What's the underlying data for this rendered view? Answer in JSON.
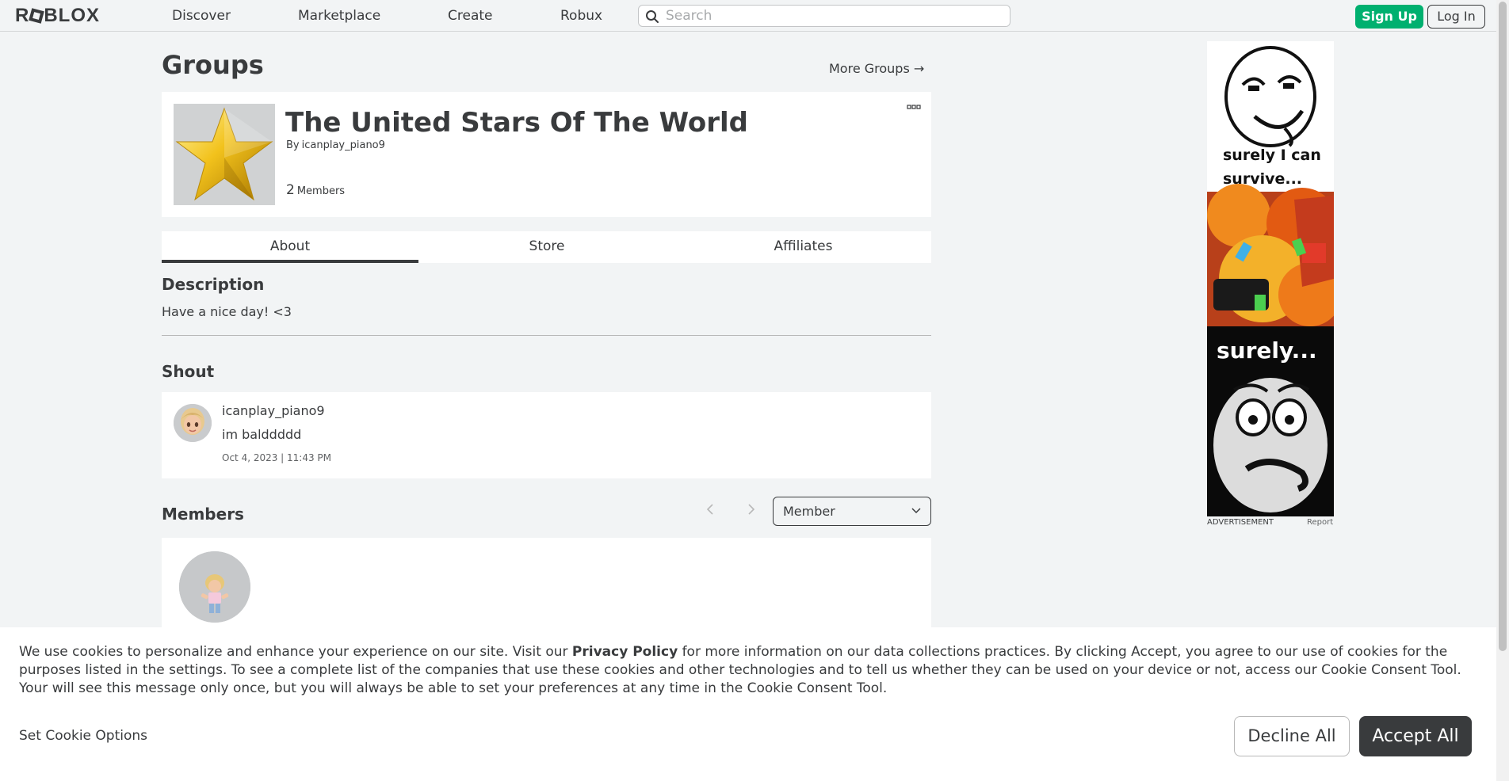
{
  "nav": {
    "logo": "ROBLOX",
    "logo_left": "R",
    "logo_right": "BLOX",
    "links": [
      "Discover",
      "Marketplace",
      "Create",
      "Robux"
    ],
    "search_placeholder": "Search",
    "signup_label": "Sign Up",
    "login_label": "Log In"
  },
  "page": {
    "title": "Groups",
    "more_groups": "More Groups →"
  },
  "group": {
    "name": "The United Stars Of The World",
    "by_label": "By",
    "owner": "icanplay_piano9",
    "member_count": "2",
    "member_label": "Members"
  },
  "tabs": [
    "About",
    "Store",
    "Affiliates"
  ],
  "active_tab": "About",
  "description": {
    "title": "Description",
    "text": "Have a nice day! <3"
  },
  "shout": {
    "title": "Shout",
    "user": "icanplay_piano9",
    "message": "im balddddd",
    "date": "Oct 4, 2023 | 11:43 PM"
  },
  "members": {
    "title": "Members",
    "role_selected": "Member"
  },
  "ad": {
    "caption_top": "surely I can survive...",
    "caption_bottom": "surely...",
    "footer_label": "ADVERTISEMENT",
    "report_label": "Report"
  },
  "cookie": {
    "text_before": "We use cookies to personalize and enhance your experience on our site. Visit our ",
    "link": "Privacy Policy",
    "text_after": " for more information on our data collections practices. By clicking Accept, you agree to our use of cookies for the purposes listed in the settings. To see a complete list of the companies that use these cookies and other technologies and to tell us whether they can be used on your device or not, access our Cookie Consent Tool. Your will see this message only once, but you will always be able to set your preferences at any time in the Cookie Consent Tool.",
    "options_label": "Set Cookie Options",
    "decline_label": "Decline All",
    "accept_label": "Accept All"
  },
  "colors": {
    "signup": "#00b06f",
    "accept": "#393b3d",
    "background": "#f2f4f5"
  }
}
